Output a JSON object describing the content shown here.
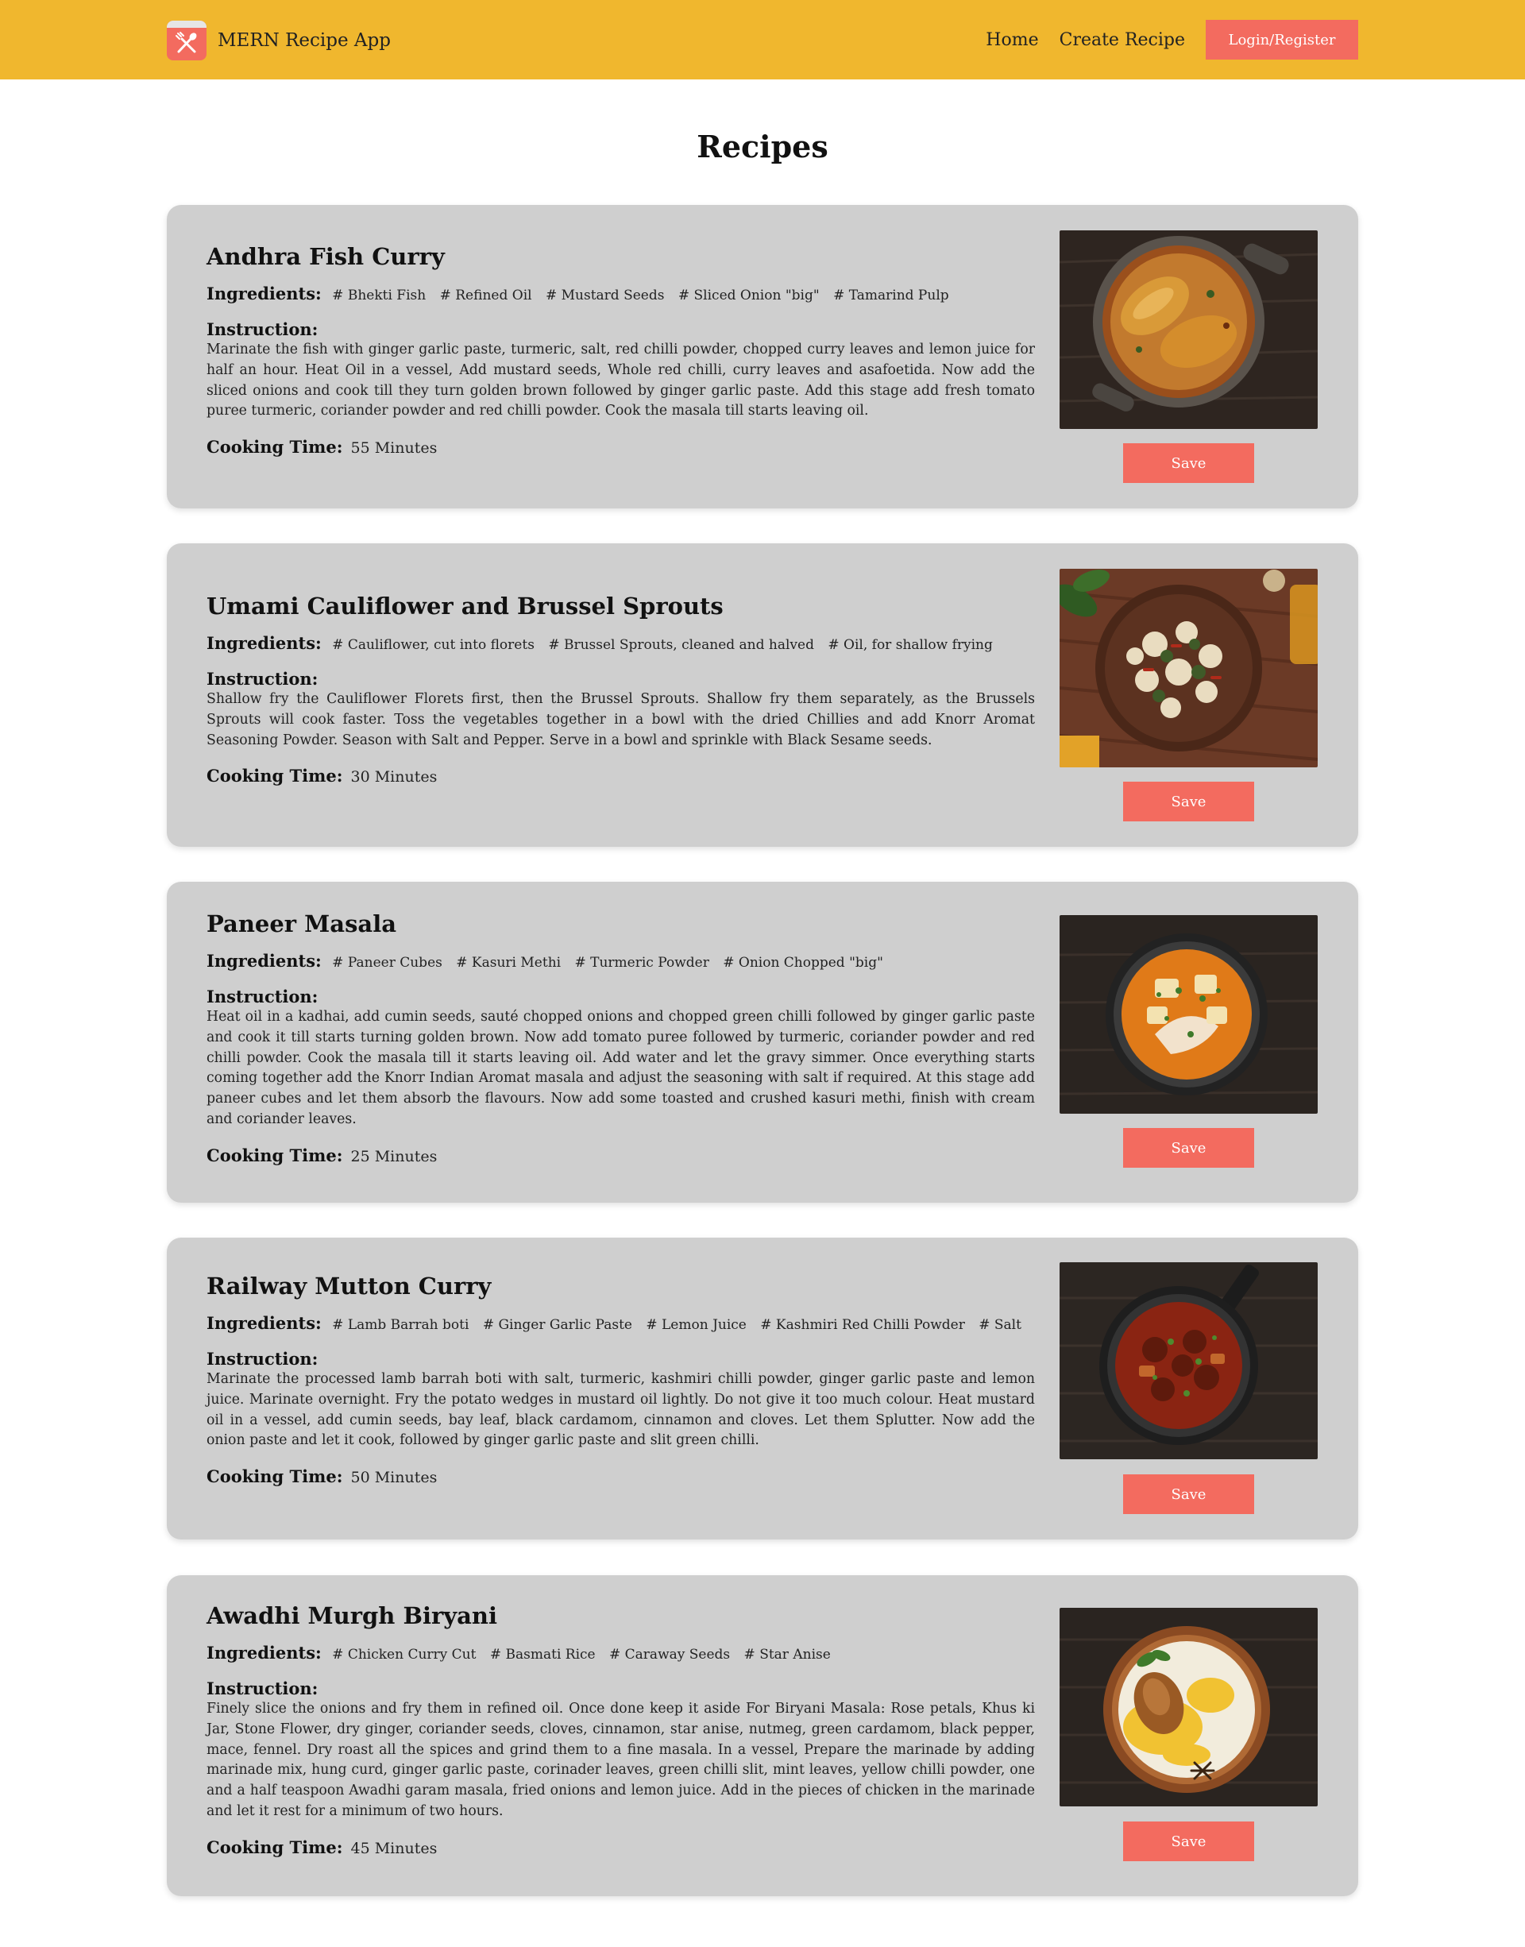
{
  "header": {
    "brand": "MERN Recipe App",
    "nav": [
      "Home",
      "Create Recipe"
    ],
    "login_label": "Login/Register"
  },
  "page_title": "Recipes",
  "labels": {
    "ingredients": "Ingredients:",
    "instruction": "Instruction:",
    "cooking_time": "Cooking Time:",
    "save": "Save"
  },
  "recipes": [
    {
      "name": "Andhra Fish Curry",
      "ingredients": [
        "# Bhekti Fish",
        "# Refined Oil",
        "# Mustard Seeds",
        "# Sliced Onion \"big\"",
        "# Tamarind Pulp"
      ],
      "instruction": "Marinate the fish with ginger garlic paste, turmeric, salt, red chilli powder, chopped curry leaves and lemon juice for half an hour. Heat Oil in a vessel, Add mustard seeds, Whole red chilli, curry leaves and asafoetida. Now add the sliced onions and cook till they turn golden brown followed by ginger garlic paste. Add this stage add fresh tomato puree turmeric, coriander powder and red chilli powder. Cook the masala till starts leaving oil.",
      "cooking_time": "55 Minutes"
    },
    {
      "name": "Umami Cauliflower and Brussel Sprouts",
      "ingredients": [
        "# Cauliflower, cut into florets",
        "# Brussel Sprouts, cleaned and halved",
        "# Oil, for shallow frying"
      ],
      "instruction": "Shallow fry the Cauliflower Florets first, then the Brussel Sprouts. Shallow fry them separately, as the Brussels Sprouts will cook faster. Toss the vegetables together in a bowl with the dried Chillies and add Knorr Aromat Seasoning Powder. Season with Salt and Pepper. Serve in a bowl and sprinkle with Black Sesame seeds.",
      "cooking_time": "30 Minutes"
    },
    {
      "name": "Paneer Masala",
      "ingredients": [
        "# Paneer Cubes",
        "# Kasuri Methi",
        "# Turmeric Powder",
        "# Onion Chopped \"big\""
      ],
      "instruction": "Heat oil in a kadhai, add cumin seeds, sauté chopped onions and chopped green chilli followed by ginger garlic paste and cook it till starts turning golden brown. Now add tomato puree followed by turmeric, coriander powder and red chilli powder. Cook the masala till it starts leaving oil. Add water and let the gravy simmer. Once everything starts coming together add the Knorr Indian Aromat masala and adjust the seasoning with salt if required. At this stage add paneer cubes and let them absorb the flavours. Now add some toasted and crushed kasuri methi, finish with cream and coriander leaves.",
      "cooking_time": "25 Minutes"
    },
    {
      "name": "Railway Mutton Curry",
      "ingredients": [
        "# Lamb Barrah boti",
        "# Ginger Garlic Paste",
        "# Lemon Juice",
        "# Kashmiri Red Chilli Powder",
        "# Salt"
      ],
      "instruction": "Marinate the processed lamb barrah boti with salt, turmeric, kashmiri chilli powder, ginger garlic paste and lemon juice. Marinate overnight. Fry the potato wedges in mustard oil lightly. Do not give it too much colour. Heat mustard oil in a vessel, add cumin seeds, bay leaf, black cardamom, cinnamon and cloves. Let them Splutter. Now add the onion paste and let it cook, followed by ginger garlic paste and slit green chilli.",
      "cooking_time": "50 Minutes"
    },
    {
      "name": "Awadhi Murgh Biryani",
      "ingredients": [
        "# Chicken Curry Cut",
        "# Basmati Rice",
        "# Caraway Seeds",
        "# Star Anise"
      ],
      "instruction": "Finely slice the onions and fry them in refined oil. Once done keep it aside For Biryani Masala: Rose petals, Khus ki Jar, Stone Flower, dry ginger, coriander seeds, cloves, cinnamon, star anise, nutmeg, green cardamom, black pepper, mace, fennel. Dry roast all the spices and grind them to a fine masala. In a vessel, Prepare the marinade by adding marinade mix, hung curd, ginger garlic paste, corinader leaves, green chilli slit, mint leaves, yellow chilli powder, one and a half teaspoon Awadhi garam masala, fried onions and lemon juice. Add in the pieces of chicken in the marinade and let it rest for a minimum of two hours.",
      "cooking_time": "45 Minutes"
    }
  ]
}
